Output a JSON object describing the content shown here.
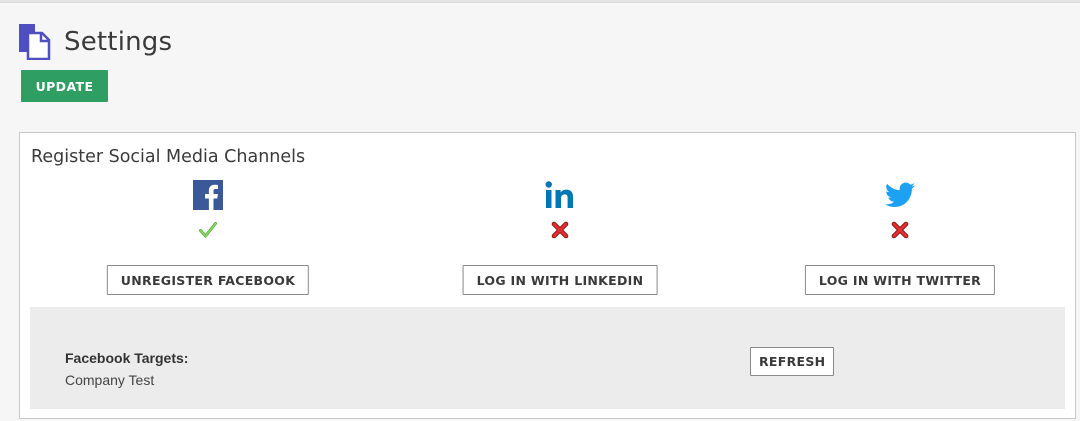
{
  "header": {
    "title": "Settings",
    "icon": "settings-page-icon"
  },
  "toolbar": {
    "update_label": "UPDATE"
  },
  "colors": {
    "update_button": "#2e9e62",
    "facebook": "#3b5998",
    "linkedin": "#0077b5",
    "twitter": "#1da1f2",
    "check": "#6cc04a",
    "error": "#d62020",
    "icon_primary": "#4f4fbf"
  },
  "social_panel": {
    "title": "Register Social Media Channels",
    "channels": [
      {
        "name": "facebook",
        "icon": "facebook-icon",
        "status": "registered",
        "status_icon": "check-icon",
        "button_label": "UNREGISTER FACEBOOK"
      },
      {
        "name": "linkedin",
        "icon": "linkedin-icon",
        "status": "not-registered",
        "status_icon": "x-icon",
        "button_label": "LOG IN WITH LINKEDIN"
      },
      {
        "name": "twitter",
        "icon": "twitter-icon",
        "status": "not-registered",
        "status_icon": "x-icon",
        "button_label": "LOG IN WITH TWITTER"
      }
    ],
    "targets": {
      "label": "Facebook Targets:",
      "value": "Company Test",
      "refresh_label": "REFRESH"
    }
  }
}
